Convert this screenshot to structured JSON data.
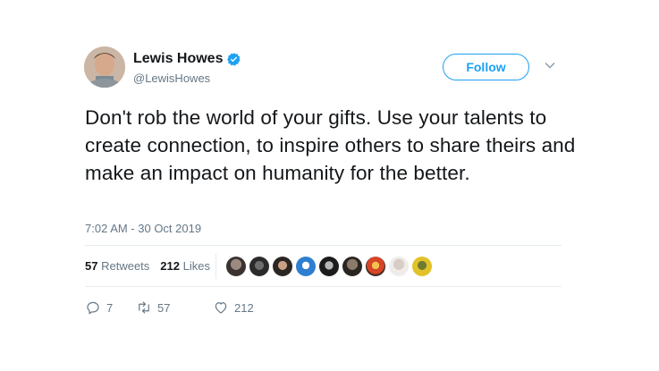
{
  "author": {
    "name": "Lewis Howes",
    "handle": "@LewisHowes",
    "verified": true
  },
  "follow_label": "Follow",
  "tweet_text": "Don't rob the world of your gifts. Use your talents to create connection, to inspire others to share theirs and make an impact on humanity for the better.",
  "timestamp": "7:02 AM - 30 Oct 2019",
  "stats": {
    "retweets_count": "57",
    "retweets_label": "Retweets",
    "likes_count": "212",
    "likes_label": "Likes"
  },
  "actions": {
    "reply_count": "7",
    "retweet_count": "57",
    "like_count": "212"
  },
  "colors": {
    "accent": "#1da1f2",
    "secondary_text": "#657786",
    "primary_text": "#14171a",
    "divider": "#e6ecf0"
  },
  "icons": [
    "verified-badge-icon",
    "chevron-down-icon",
    "reply-icon",
    "retweet-icon",
    "heart-icon"
  ]
}
